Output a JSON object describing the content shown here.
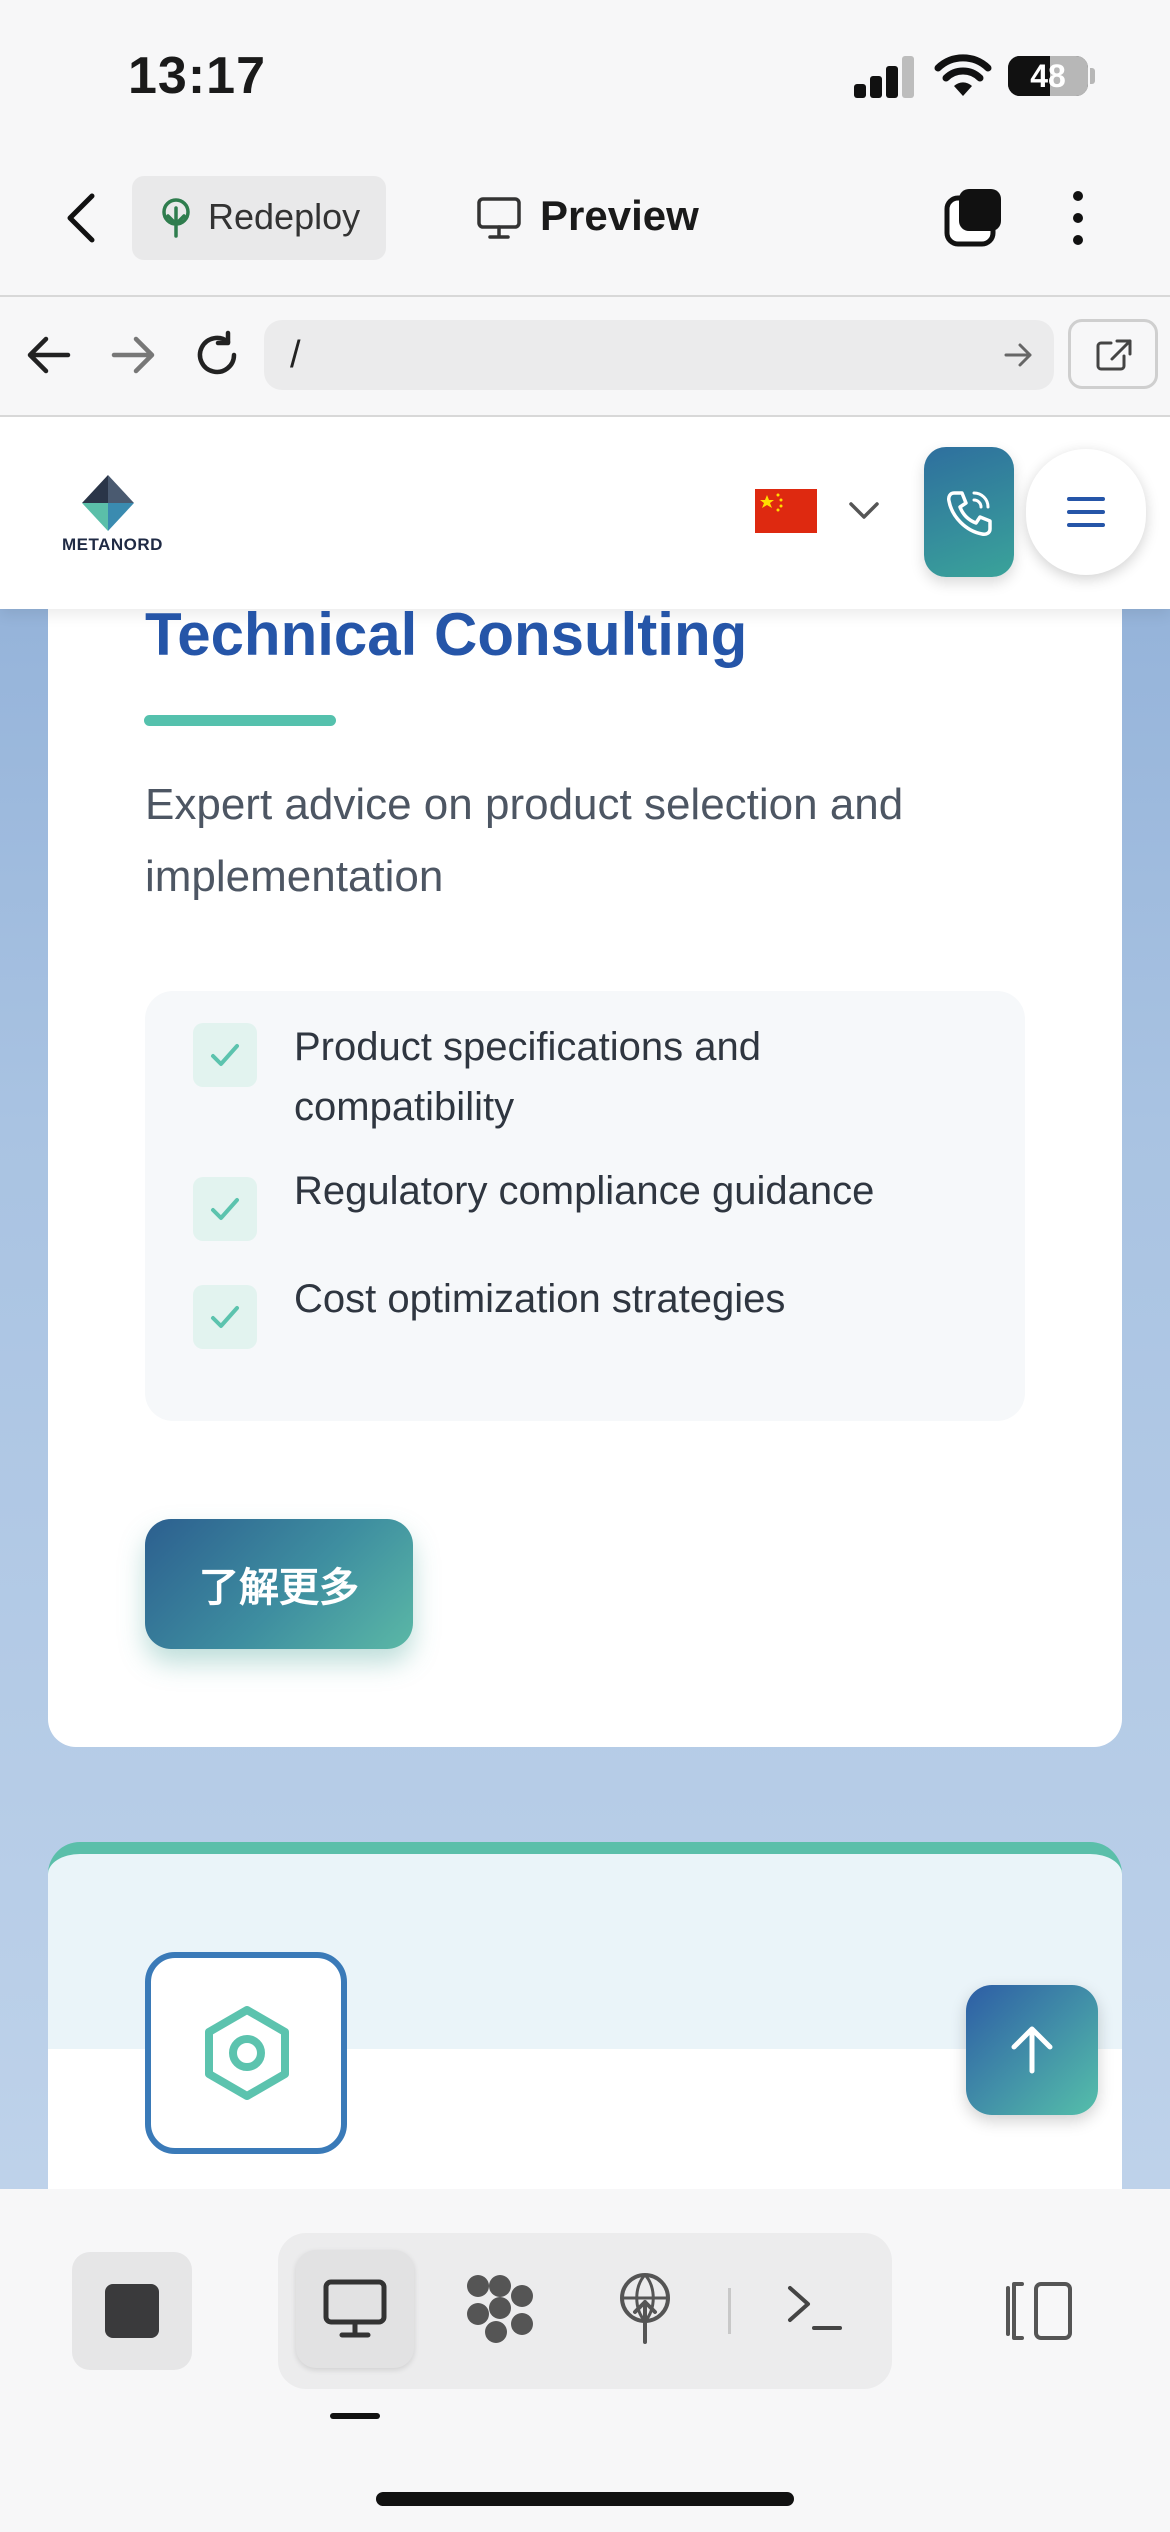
{
  "status_bar": {
    "time": "13:17",
    "battery": "48"
  },
  "app_header": {
    "back_icon": "chevron-left-icon",
    "redeploy_label": "Redeploy",
    "preview_label": "Preview"
  },
  "url_bar": {
    "url": "/"
  },
  "site": {
    "logo_text": "METANORD",
    "language_flag": "CN",
    "colors": {
      "primary_blue": "#2555a8",
      "accent_teal": "#55c1ad"
    }
  },
  "card": {
    "title": "Technical Consulting",
    "description": "Expert advice on product selection and implementation",
    "features": [
      {
        "text": "Product specifications and compatibility"
      },
      {
        "text": "Regulatory compliance guidance"
      },
      {
        "text": "Cost optimization strategies"
      }
    ],
    "button_label": "了解更多"
  }
}
